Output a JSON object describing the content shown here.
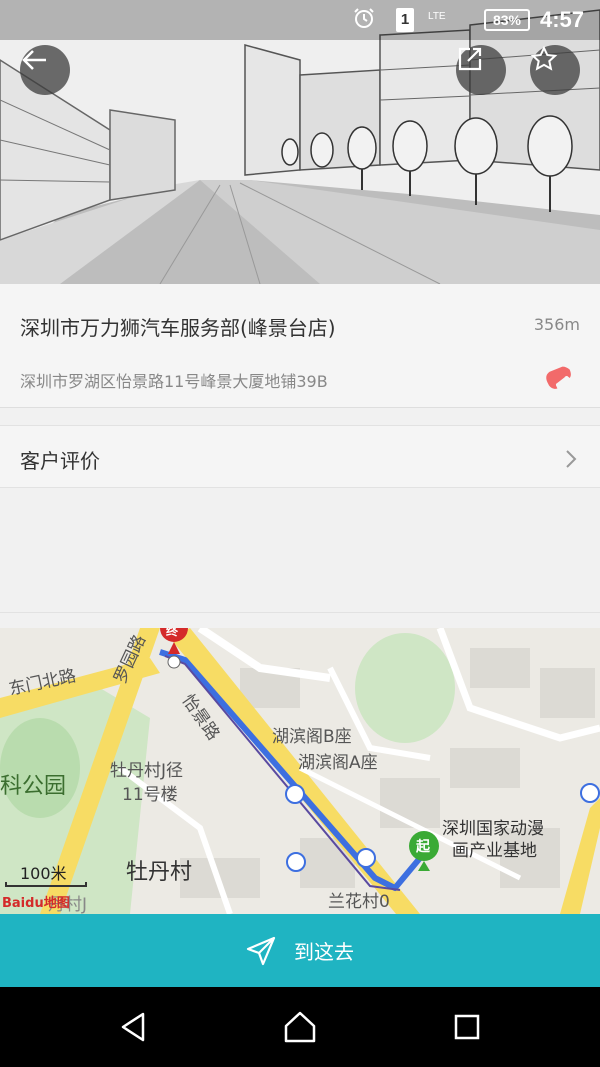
{
  "status_bar": {
    "sim_slot": "1",
    "network": "LTE",
    "battery": "83%",
    "time": "4:57"
  },
  "icons": {
    "back": "arrow-left-icon",
    "share": "share-icon",
    "favorite": "star-icon",
    "phone": "phone-icon",
    "navigate": "navigation-arrow-icon"
  },
  "shop": {
    "name": "深圳市万力狮汽车服务部(峰景台店)",
    "distance": "356m",
    "address": "深圳市罗湖区怡景路11号峰景大厦地铺39B"
  },
  "review": {
    "label": "客户评价"
  },
  "map": {
    "labels": {
      "dongmen": "东门北路",
      "taiyuan": "罗园路",
      "yijing": "怡景路",
      "park": "科公园",
      "mudan_j": "牡丹村J径",
      "building11": "11号楼",
      "mudan": "牡丹村",
      "hubin_b": "湖滨阁B座",
      "hubin_a": "湖滨阁A座",
      "anime_base_1": "深圳国家动漫",
      "anime_base_2": "画产业基地",
      "lanhua": "兰花村0",
      "danjv": "丹村J",
      "scale": "100米",
      "start_marker": "起",
      "end_marker": "终",
      "baidu": "Baidu地图"
    }
  },
  "action": {
    "navigate_label": "到这去"
  },
  "colors": {
    "accent": "#1fb4c2",
    "phone": "#f26a6a",
    "route": "#3d6fe0",
    "start_marker": "#3aaa35",
    "end_marker": "#d42a2a"
  }
}
